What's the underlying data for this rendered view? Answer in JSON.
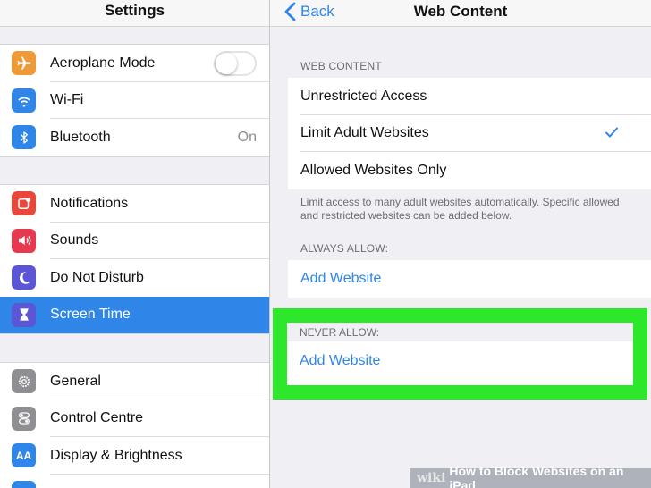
{
  "sidebar": {
    "title": "Settings",
    "groups": [
      {
        "items": [
          {
            "label": "Aeroplane Mode",
            "icon": "airplane-icon",
            "color": "#f09a37",
            "accessory": "toggle-off"
          },
          {
            "label": "Wi-Fi",
            "icon": "wifi-icon",
            "color": "#2f86e8"
          },
          {
            "label": "Bluetooth",
            "icon": "bluetooth-icon",
            "color": "#2f86e8",
            "value": "On"
          }
        ]
      },
      {
        "items": [
          {
            "label": "Notifications",
            "icon": "notifications-icon",
            "color": "#e9473c"
          },
          {
            "label": "Sounds",
            "icon": "sounds-icon",
            "color": "#e6394f"
          },
          {
            "label": "Do Not Disturb",
            "icon": "moon-icon",
            "color": "#5b56d6"
          },
          {
            "label": "Screen Time",
            "icon": "hourglass-icon",
            "color": "#5b56d6",
            "selected": true
          }
        ]
      },
      {
        "items": [
          {
            "label": "General",
            "icon": "gear-icon",
            "color": "#8e8e93"
          },
          {
            "label": "Control Centre",
            "icon": "switches-icon",
            "color": "#8e8e93"
          },
          {
            "label": "Display & Brightness",
            "icon": "text-size-icon",
            "color": "#2f86e8",
            "glyph": "AA"
          }
        ]
      }
    ]
  },
  "detail": {
    "back_label": "Back",
    "title": "Web Content",
    "web_content_header": "WEB CONTENT",
    "options": [
      {
        "label": "Unrestricted Access",
        "checked": false
      },
      {
        "label": "Limit Adult Websites",
        "checked": true
      },
      {
        "label": "Allowed Websites Only",
        "checked": false
      }
    ],
    "footer_note": "Limit access to many adult websites automatically. Specific allowed and restricted websites can be added below.",
    "always_allow_header": "ALWAYS ALLOW:",
    "always_allow_add": "Add Website",
    "never_allow_header": "NEVER ALLOW:",
    "never_allow_add": "Add Website"
  },
  "colors": {
    "accent": "#2f86e8",
    "highlight": "#2de82a"
  },
  "watermark": {
    "brand": "wiki",
    "text": "How to Block Websites on an iPad"
  }
}
